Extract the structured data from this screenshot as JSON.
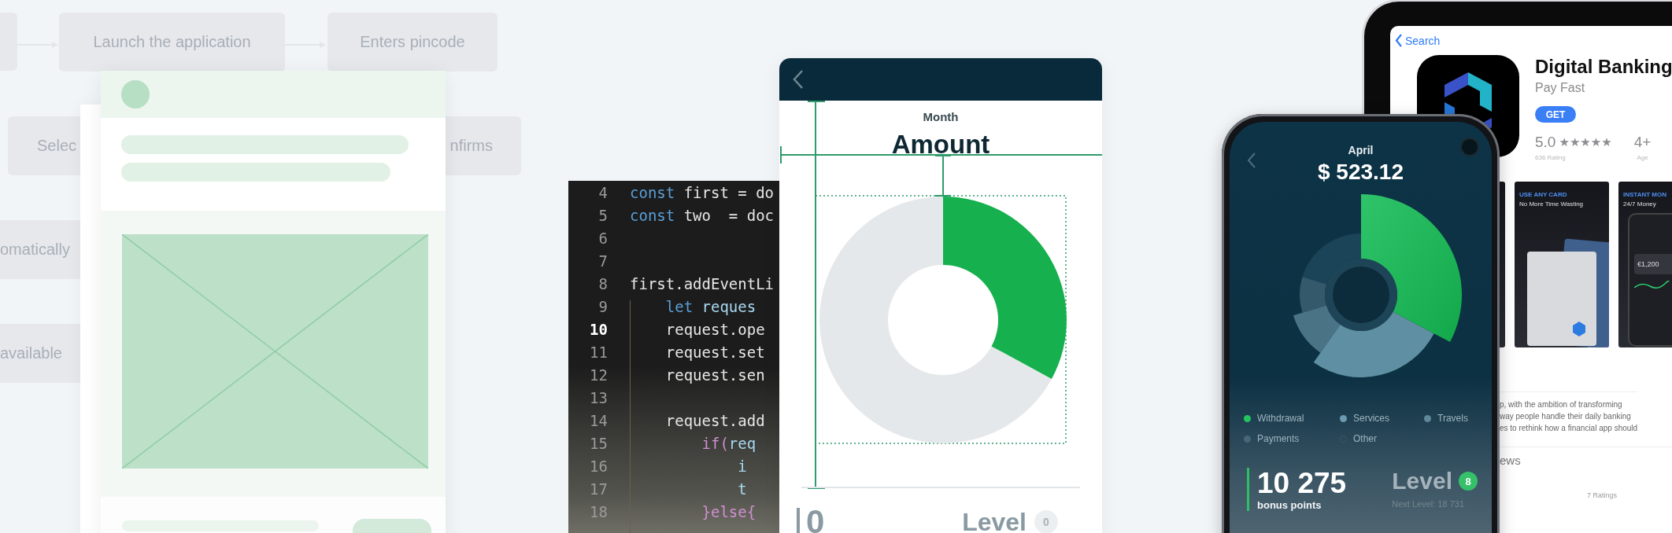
{
  "flowchart": {
    "steps": [
      {
        "label": "Launch the application"
      },
      {
        "label": "Enters pincode"
      },
      {
        "label": "Selec"
      },
      {
        "label": "nfirms"
      },
      {
        "label": "omatically"
      },
      {
        "label": "available"
      }
    ]
  },
  "code_editor": {
    "lines": [
      {
        "number": "4",
        "current": false,
        "tokens": [
          {
            "text": "const ",
            "kind": "keyword"
          },
          {
            "text": "first = do",
            "kind": "plain"
          }
        ]
      },
      {
        "number": "5",
        "current": false,
        "tokens": [
          {
            "text": "const ",
            "kind": "keyword"
          },
          {
            "text": "two  = doc",
            "kind": "plain"
          }
        ]
      },
      {
        "number": "6",
        "current": false
      },
      {
        "number": "7",
        "current": false
      },
      {
        "number": "8",
        "current": false,
        "tokens": [
          {
            "text": "first.addEventLi",
            "kind": "plain"
          }
        ]
      },
      {
        "number": "9",
        "current": false,
        "tokens": [
          {
            "text": "    let ",
            "kind": "keyword"
          },
          {
            "text": "reques",
            "kind": "variable"
          }
        ]
      },
      {
        "number": "10",
        "current": true,
        "tokens": [
          {
            "text": "    request.ope",
            "kind": "plain"
          }
        ]
      },
      {
        "number": "11",
        "current": false,
        "tokens": [
          {
            "text": "    request.set",
            "kind": "plain"
          }
        ]
      },
      {
        "number": "12",
        "current": false,
        "tokens": [
          {
            "text": "    request.sen",
            "kind": "plain"
          }
        ]
      },
      {
        "number": "13",
        "current": false
      },
      {
        "number": "14",
        "current": false,
        "tokens": [
          {
            "text": "    request.add",
            "kind": "plain"
          }
        ]
      },
      {
        "number": "15",
        "current": false,
        "tokens": [
          {
            "text": "        if(",
            "kind": "control"
          },
          {
            "text": "req",
            "kind": "variable"
          }
        ]
      },
      {
        "number": "16",
        "current": false,
        "tokens": [
          {
            "text": "            i",
            "kind": "variable"
          }
        ]
      },
      {
        "number": "17",
        "current": false,
        "tokens": [
          {
            "text": "            t",
            "kind": "variable"
          }
        ]
      },
      {
        "number": "18",
        "current": false,
        "tokens": [
          {
            "text": "        }else{",
            "kind": "control"
          }
        ]
      }
    ]
  },
  "chart_card": {
    "subtitle": "Month",
    "title": "Amount",
    "value": "0",
    "level_label": "Level",
    "level_badge": "0"
  },
  "phone": {
    "month": "April",
    "amount": "$ 523.12",
    "legend": [
      {
        "label": "Withdrawal",
        "color": "#22c55e",
        "kind": "filled"
      },
      {
        "label": "Services",
        "color": "#6a9bb0",
        "kind": "filled"
      },
      {
        "label": "Travels",
        "color": "#5f8799",
        "kind": "filled"
      },
      {
        "label": "Payments",
        "color": "#476677",
        "kind": "filled"
      },
      {
        "label": "Other",
        "color": "#3c5868",
        "kind": "hollow"
      }
    ],
    "points": "10 275",
    "points_label": "bonus points",
    "level_label": "Level",
    "level_badge": "8",
    "next_level": "Next Level: 18 731"
  },
  "app_store": {
    "back": "Search",
    "app_name": "Digital Banking",
    "subtitle": "Pay Fast",
    "get_button": "GET",
    "rating": "5.0",
    "stars": 5,
    "rating_count": "636 Rating",
    "age": "4+",
    "age_label": "Age",
    "screenshots": [
      {
        "kind": "blank"
      },
      {
        "kind": "cards",
        "heading": "USE ANY CARD",
        "caption": "No More Time Wasting"
      },
      {
        "kind": "phone",
        "heading": "INSTANT MON",
        "caption": "24/7 Money",
        "amount": "€1,200"
      }
    ],
    "description": [
      "p, with the ambition of transforming",
      "way people handle their daily banking",
      "es to rethink how a financial app should"
    ],
    "section_heading": "ews",
    "ratings_note": "7 Ratings"
  }
}
